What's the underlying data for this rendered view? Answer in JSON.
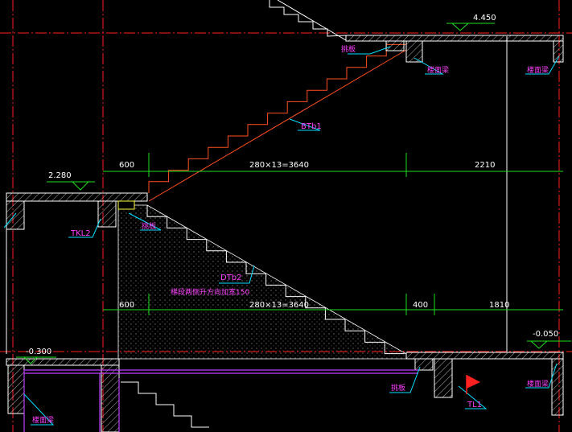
{
  "drawing": {
    "elevations": {
      "top_right": "4.450",
      "mid_left": "2.280",
      "low_left": "-0.300",
      "low_right": "-0.050"
    },
    "dimensions": {
      "upper_left": "600",
      "upper_run": "280×13=3640",
      "upper_right": "2210",
      "lower_left": "600",
      "lower_run": "280×13=3640",
      "lower_mid": "400",
      "lower_right": "1810"
    },
    "labels": {
      "bt_label": "BTb1",
      "dt_label": "DTb2",
      "dt_note": "梯段两侧升方向加宽150",
      "tkl_label": "TKL2",
      "tl_label": "TL1",
      "plate_top": "挑板",
      "beam_top_mid": "楼面梁",
      "beam_top_right": "楼面梁",
      "plate_mid": "挑板",
      "beam_bottom_left": "楼面梁",
      "plate_bottom": "挑板",
      "beam_bottom_right": "楼面梁"
    },
    "colors": {
      "background": "#000000",
      "red_axis": "#ff2020",
      "dimension": "#20e020",
      "slab": "#ffffff",
      "stair_bt": "#ff5020",
      "leader": "#00e0ff",
      "label_text": "#ff40ff",
      "flag": "#ff2020",
      "purple_line": "#c040ff"
    }
  }
}
